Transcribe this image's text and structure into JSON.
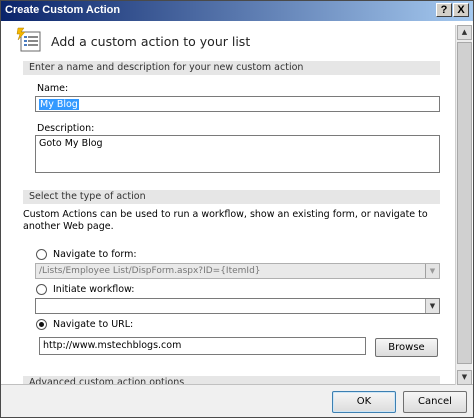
{
  "window": {
    "title": "Create Custom Action",
    "help_glyph": "?",
    "close_glyph": "X"
  },
  "header": {
    "title": "Add a custom action to your list"
  },
  "section_name": {
    "heading": "Enter a name and description for your new custom action",
    "name_label": "Name:",
    "name_value": "My Blog",
    "description_label": "Description:",
    "description_value": "Goto My Blog"
  },
  "section_action": {
    "heading": "Select the type of action",
    "help_text": "Custom Actions can be used to run a workflow, show an existing form, or navigate to another Web page.",
    "options": [
      {
        "label": "Navigate to form:",
        "selected": false
      },
      {
        "label": "Initiate workflow:",
        "selected": false
      },
      {
        "label": "Navigate to URL:",
        "selected": true
      }
    ],
    "form_dropdown_value": "/Lists/Employee List/DispForm.aspx?ID={ItemId}",
    "workflow_dropdown_value": "",
    "url_value": "http://www.mstechblogs.com",
    "browse_label": "Browse"
  },
  "section_advanced": {
    "heading": "Advanced custom action options"
  },
  "footer": {
    "ok_label": "OK",
    "cancel_label": "Cancel"
  },
  "icons": {
    "header_icon": "custom-action-icon",
    "dropdown_arrow": "chevron-down-icon",
    "scroll_up": "scroll-up-icon",
    "scroll_down": "scroll-down-icon"
  },
  "colors": {
    "title_bar_start": "#0a246a",
    "title_bar_end": "#a6caf0",
    "selection": "#3399ff",
    "section_bar": "#e6e6e6"
  }
}
